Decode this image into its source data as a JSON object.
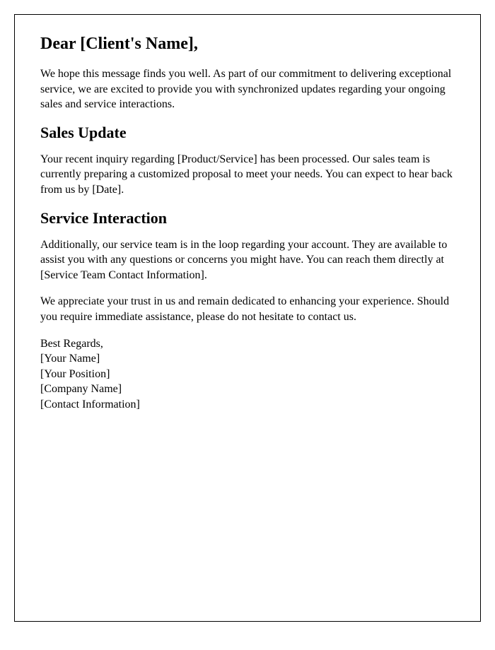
{
  "greeting": "Dear [Client's Name],",
  "intro_paragraph": "We hope this message finds you well. As part of our commitment to delivering exceptional service, we are excited to provide you with synchronized updates regarding your ongoing sales and service interactions.",
  "sections": {
    "sales_update": {
      "heading": "Sales Update",
      "body": "Your recent inquiry regarding [Product/Service] has been processed. Our sales team is currently preparing a customized proposal to meet your needs. You can expect to hear back from us by [Date]."
    },
    "service_interaction": {
      "heading": "Service Interaction",
      "body": "Additionally, our service team is in the loop regarding your account. They are available to assist you with any questions or concerns you might have. You can reach them directly at [Service Team Contact Information]."
    }
  },
  "closing_paragraph": "We appreciate your trust in us and remain dedicated to enhancing your experience. Should you require immediate assistance, please do not hesitate to contact us.",
  "signature": {
    "closing": "Best Regards,",
    "name": "[Your Name]",
    "position": "[Your Position]",
    "company": "[Company Name]",
    "contact": "[Contact Information]"
  }
}
